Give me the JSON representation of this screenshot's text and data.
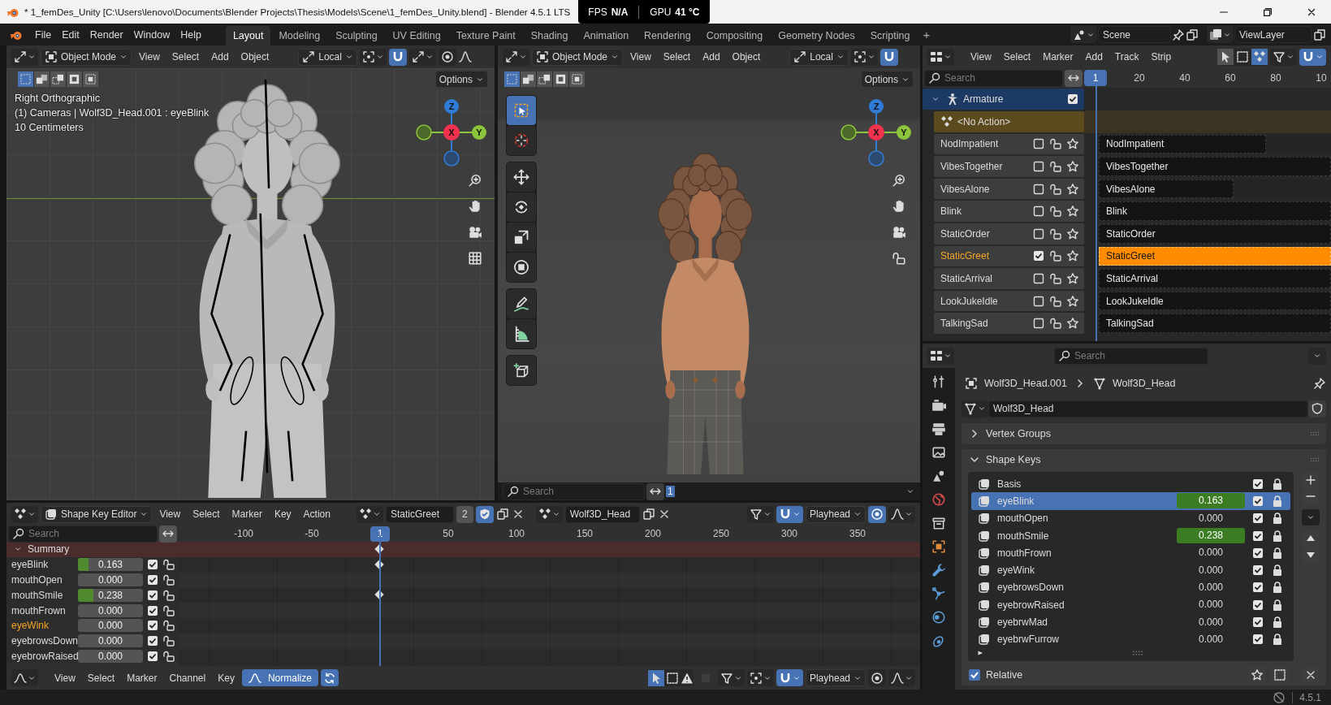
{
  "title_bar": {
    "title": "* 1_femDes_Unity [C:\\Users\\lenovo\\Documents\\Blender Projects\\Thesis\\Models\\Scene\\1_femDes_Unity.blend] - Blender 4.5.1 LTS",
    "fps_label": "FPS",
    "fps_value": "N/A",
    "gpu_label": "GPU",
    "gpu_value": "41 °C"
  },
  "top_bar": {
    "menus": [
      "File",
      "Edit",
      "Render",
      "Window",
      "Help"
    ],
    "workspaces": [
      {
        "label": "Layout",
        "selected": true
      },
      {
        "label": "Modeling",
        "selected": false
      },
      {
        "label": "Sculpting",
        "selected": false
      },
      {
        "label": "UV Editing",
        "selected": false
      },
      {
        "label": "Texture Paint",
        "selected": false
      },
      {
        "label": "Shading",
        "selected": false
      },
      {
        "label": "Animation",
        "selected": false
      },
      {
        "label": "Rendering",
        "selected": false
      },
      {
        "label": "Compositing",
        "selected": false
      },
      {
        "label": "Geometry Nodes",
        "selected": false
      },
      {
        "label": "Scripting",
        "selected": false
      }
    ],
    "add_workspace": "+",
    "scene": "Scene",
    "view_layer": "ViewLayer"
  },
  "viewports": [
    {
      "kind": "orthographic",
      "mode": "Object Mode",
      "menus": [
        "View",
        "Select",
        "Add",
        "Object"
      ],
      "orientation": "Local",
      "options": "Options",
      "info": [
        "Right Orthographic",
        "(1) Cameras | Wolf3D_Head.001 : eyeBlink",
        "10 Centimeters"
      ],
      "axes": [
        "Z",
        "X",
        "Y"
      ]
    },
    {
      "kind": "perspective",
      "mode": "Object Mode",
      "menus": [
        "View",
        "Select",
        "Add",
        "Object"
      ],
      "orientation": "Local",
      "options": "Options",
      "axes": [
        "Z",
        "X",
        "Y"
      ],
      "footer": {
        "placeholder": "Search",
        "frame": "1"
      }
    }
  ],
  "nla": {
    "menus": [
      "View",
      "Select",
      "Marker",
      "Add",
      "Track",
      "Strip"
    ],
    "search_placeholder": "Search",
    "ruler": [
      {
        "label": "1",
        "selected": true
      },
      {
        "label": "20",
        "selected": false
      },
      {
        "label": "40",
        "selected": false
      },
      {
        "label": "60",
        "selected": false
      },
      {
        "label": "80",
        "selected": false
      },
      {
        "label": "10",
        "selected": false
      }
    ],
    "object": {
      "name": "Armature",
      "checked": true
    },
    "action": "<No Action>",
    "tracks": [
      {
        "name": "NodImpatient",
        "selected": false,
        "checked": false,
        "strip": "NodImpatient",
        "level": 0.72
      },
      {
        "name": "VibesTogether",
        "selected": false,
        "checked": false,
        "strip": "VibesTogether",
        "level": 1
      },
      {
        "name": "VibesAlone",
        "selected": false,
        "checked": false,
        "strip": "VibesAlone",
        "level": 0.58
      },
      {
        "name": "Blink",
        "selected": false,
        "checked": false,
        "strip": "Blink",
        "level": 1
      },
      {
        "name": "StaticOrder",
        "selected": false,
        "checked": false,
        "strip": "StaticOrder",
        "level": 1
      },
      {
        "name": "StaticGreet",
        "selected": true,
        "checked": true,
        "strip": "StaticGreet",
        "level": 1
      },
      {
        "name": "StaticArrival",
        "selected": false,
        "checked": false,
        "strip": "StaticArrival",
        "level": 1
      },
      {
        "name": "LookJukeIdle",
        "selected": false,
        "checked": false,
        "strip": "LookJukeIdle",
        "level": 1
      },
      {
        "name": "TalkingSad",
        "selected": false,
        "checked": false,
        "strip": "TalkingSad",
        "level": 1
      }
    ]
  },
  "properties": {
    "search_placeholder": "Search",
    "breadcrumb": [
      "Wolf3D_Head.001",
      "Wolf3D_Head"
    ],
    "mesh_name": "Wolf3D_Head",
    "panels": [
      {
        "title": "Vertex Groups",
        "expanded": false
      },
      {
        "title": "Shape Keys",
        "expanded": true
      }
    ],
    "shape_keys": [
      {
        "name": "Basis",
        "selected": false,
        "checked": true
      },
      {
        "name": "eyeBlink",
        "value": "0.163",
        "keyed": true,
        "selected": true,
        "checked": true
      },
      {
        "name": "mouthOpen",
        "value": "0.000",
        "keyed": false,
        "selected": false,
        "checked": true
      },
      {
        "name": "mouthSmile",
        "value": "0.238",
        "keyed": true,
        "selected": false,
        "checked": true
      },
      {
        "name": "mouthFrown",
        "value": "0.000",
        "keyed": false,
        "selected": false,
        "checked": true
      },
      {
        "name": "eyeWink",
        "value": "0.000",
        "keyed": false,
        "selected": false,
        "checked": true
      },
      {
        "name": "eyebrowsDown",
        "value": "0.000",
        "keyed": false,
        "selected": false,
        "checked": true
      },
      {
        "name": "eyebrowRaised",
        "value": "0.000",
        "keyed": false,
        "selected": false,
        "checked": true
      },
      {
        "name": "eyebrwMad",
        "value": "0.000",
        "keyed": false,
        "selected": false,
        "checked": true
      },
      {
        "name": "eyebrwFurrow",
        "value": "0.000",
        "keyed": false,
        "selected": false,
        "checked": true
      }
    ],
    "relative": {
      "label": "Relative",
      "checked": true
    }
  },
  "shape_key_editor": {
    "mode": "Shape Key Editor",
    "menus": [
      "View",
      "Select",
      "Marker",
      "Key",
      "Action"
    ],
    "action": "StaticGreet",
    "users": "2",
    "object": "Wolf3D_Head",
    "snap": "Playhead",
    "search_placeholder": "Search",
    "ruler": [
      {
        "label": "-100",
        "selected": false
      },
      {
        "label": "-50",
        "selected": false
      },
      {
        "label": "1",
        "selected": true
      },
      {
        "label": "50",
        "selected": false
      },
      {
        "label": "100",
        "selected": false
      },
      {
        "label": "150",
        "selected": false
      },
      {
        "label": "200",
        "selected": false
      },
      {
        "label": "250",
        "selected": false
      },
      {
        "label": "300",
        "selected": false
      },
      {
        "label": "350",
        "selected": false
      }
    ],
    "summary": {
      "label": "Summary",
      "keyframe": true
    },
    "channels": [
      {
        "name": "eyeBlink",
        "value": "0.163",
        "level": 0.163,
        "selected": false,
        "checked": true,
        "keyframe": true
      },
      {
        "name": "mouthOpen",
        "value": "0.000",
        "selected": false,
        "checked": true,
        "keyframe": false
      },
      {
        "name": "mouthSmile",
        "value": "0.238",
        "level": 0.238,
        "selected": false,
        "checked": true,
        "keyframe": true
      },
      {
        "name": "mouthFrown",
        "value": "0.000",
        "selected": false,
        "checked": true,
        "keyframe": false
      },
      {
        "name": "eyeWink",
        "value": "0.000",
        "selected": true,
        "checked": true,
        "keyframe": false
      },
      {
        "name": "eyebrowsDown",
        "value": "0.000",
        "selected": false,
        "checked": true,
        "keyframe": false
      },
      {
        "name": "eyebrowRaised",
        "value": "0.000",
        "selected": false,
        "checked": true,
        "keyframe": false
      }
    ]
  },
  "graph_editor_header": {
    "menus": [
      "View",
      "Select",
      "Marker",
      "Channel",
      "Key"
    ],
    "normalize": {
      "label": "Normalize",
      "on": true
    },
    "snap": "Playhead"
  },
  "status_bar": {
    "version": "4.5.1"
  }
}
